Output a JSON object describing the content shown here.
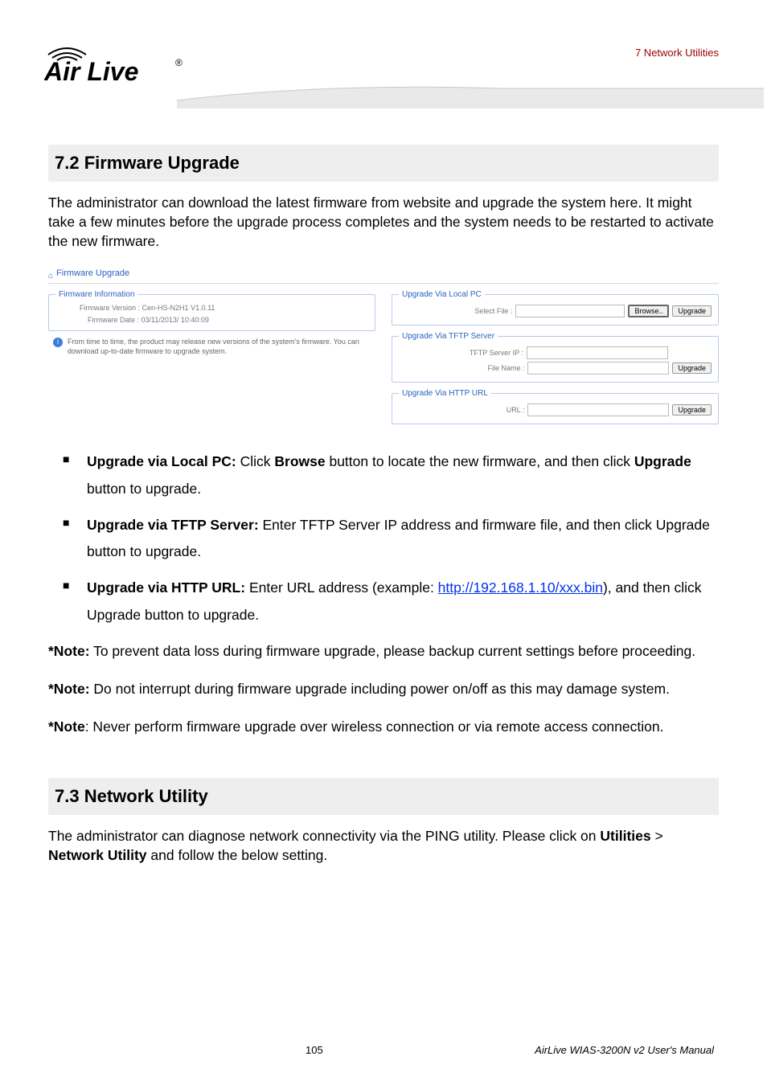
{
  "header": {
    "breadcrumb": "7 Network Utilities",
    "logo_top": "Air Live",
    "logo_reg": "®"
  },
  "sec72": {
    "title": "7.2  Firmware Upgrade",
    "intro": "The administrator can download the latest firmware from website and upgrade the system here. It might take a few minutes before the upgrade process completes and the system needs to be restarted to activate the new firmware."
  },
  "shot": {
    "home_icon": "⌂",
    "title": "Firmware Upgrade",
    "fw_info_legend": "Firmware Information",
    "fw_version_label": "Firmware Version :",
    "fw_version_value": "Cen-HS-N2H1 V1.0.11",
    "fw_date_label": "Firmware Date :",
    "fw_date_value": "03/11/2013/ 10:40:09",
    "info_text": "From time to time, the product may release new versions of the system's firmware. You can download up-to-date firmware to upgrade system.",
    "localpc_legend": "Upgrade Via Local PC",
    "select_file_label": "Select File :",
    "browse_btn": "Browse..",
    "upgrade_btn": "Upgrade",
    "tftp_legend": "Upgrade Via TFTP Server",
    "tftp_ip_label": "TFTP Server IP :",
    "file_name_label": "File Name :",
    "http_legend": "Upgrade Via HTTP URL",
    "url_label": "URL :"
  },
  "bullets": {
    "b1_lead": "Upgrade via Local PC:",
    "b1_mid": " Click ",
    "b1_bold": "Browse",
    "b1_rest": " button to locate the new firmware, and then click ",
    "b1_bold2": "Upgrade",
    "b1_end": " button to upgrade.",
    "b2_lead": "Upgrade via TFTP Server:",
    "b2_rest": " Enter TFTP Server IP address and firmware file, and then click Upgrade button to upgrade.",
    "b3_lead": "Upgrade via HTTP URL:",
    "b3_mid": " Enter URL address (example: ",
    "b3_link": "http://192.168.1.10/xxx.bin",
    "b3_end": "), and then click Upgrade button to upgrade."
  },
  "notes": {
    "n1_b": "*Note:",
    "n1": " To prevent data loss during firmware upgrade, please backup current settings before proceeding.",
    "n2_b": "*Note:",
    "n2": " Do not interrupt during firmware upgrade including power on/off as this may damage system.",
    "n3_b": "*Note",
    "n3": ": Never perform firmware upgrade over wireless connection or via remote access connection."
  },
  "sec73": {
    "title": "7.3  Network Utility",
    "p1a": "The administrator can diagnose network connectivity via the PING utility. Please click on ",
    "p1b": "Utilities",
    "p1c": " > ",
    "p1d": "Network Utility",
    "p1e": " and follow the below setting."
  },
  "footer": {
    "page": "105",
    "manual": "AirLive WIAS-3200N v2 User's Manual"
  }
}
